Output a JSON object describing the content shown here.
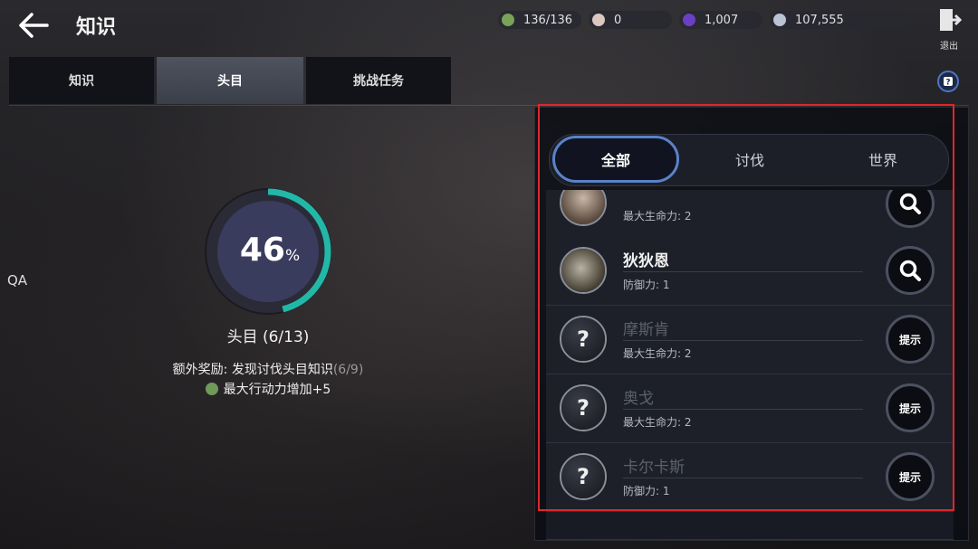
{
  "header": {
    "title": "知识",
    "exit_label": "退出"
  },
  "currencies": [
    {
      "icon": "green-leaf-icon",
      "color": "#7aa35a",
      "value": "136/136"
    },
    {
      "icon": "pearl-icon",
      "color": "#d9c7c0",
      "value": "0"
    },
    {
      "icon": "purple-orb-icon",
      "color": "#6a3fc4",
      "value": "1,007"
    },
    {
      "icon": "silver-coin-icon",
      "color": "#b9c3d4",
      "value": "107,555"
    }
  ],
  "tabs": [
    {
      "label": "知识",
      "active": false
    },
    {
      "label": "头目",
      "active": true
    },
    {
      "label": "挑战任务",
      "active": false
    }
  ],
  "sidebar": {
    "qa_label": "QA"
  },
  "progress": {
    "percent_value": "46",
    "percent_unit": "%",
    "fraction": 0.46,
    "count_label": "头目 (6/13)",
    "bonus_label": "额外奖励: 发现讨伐头目知识",
    "bonus_progress": "(6/9)",
    "reward_label": "最大行动力增加+5"
  },
  "filters": [
    {
      "label": "全部",
      "active": true
    },
    {
      "label": "讨伐",
      "active": false
    },
    {
      "label": "世界",
      "active": false
    }
  ],
  "boss_list": [
    {
      "name": "",
      "stat": "最大生命力: 2",
      "found": true,
      "action": "search-icon"
    },
    {
      "name": "狄狄恩",
      "stat": "防御力: 1",
      "found": true,
      "action": "search-icon"
    },
    {
      "name": "摩斯肯",
      "stat": "最大生命力: 2",
      "found": false,
      "action": "提示"
    },
    {
      "name": "奥戈",
      "stat": "最大生命力: 2",
      "found": false,
      "action": "提示"
    },
    {
      "name": "卡尔卡斯",
      "stat": "防御力: 1",
      "found": false,
      "action": "提示"
    }
  ],
  "colors": {
    "progress_ring": "#22b8a8",
    "highlight_box": "#e0262b",
    "active_filter_border": "#5a82c8"
  }
}
